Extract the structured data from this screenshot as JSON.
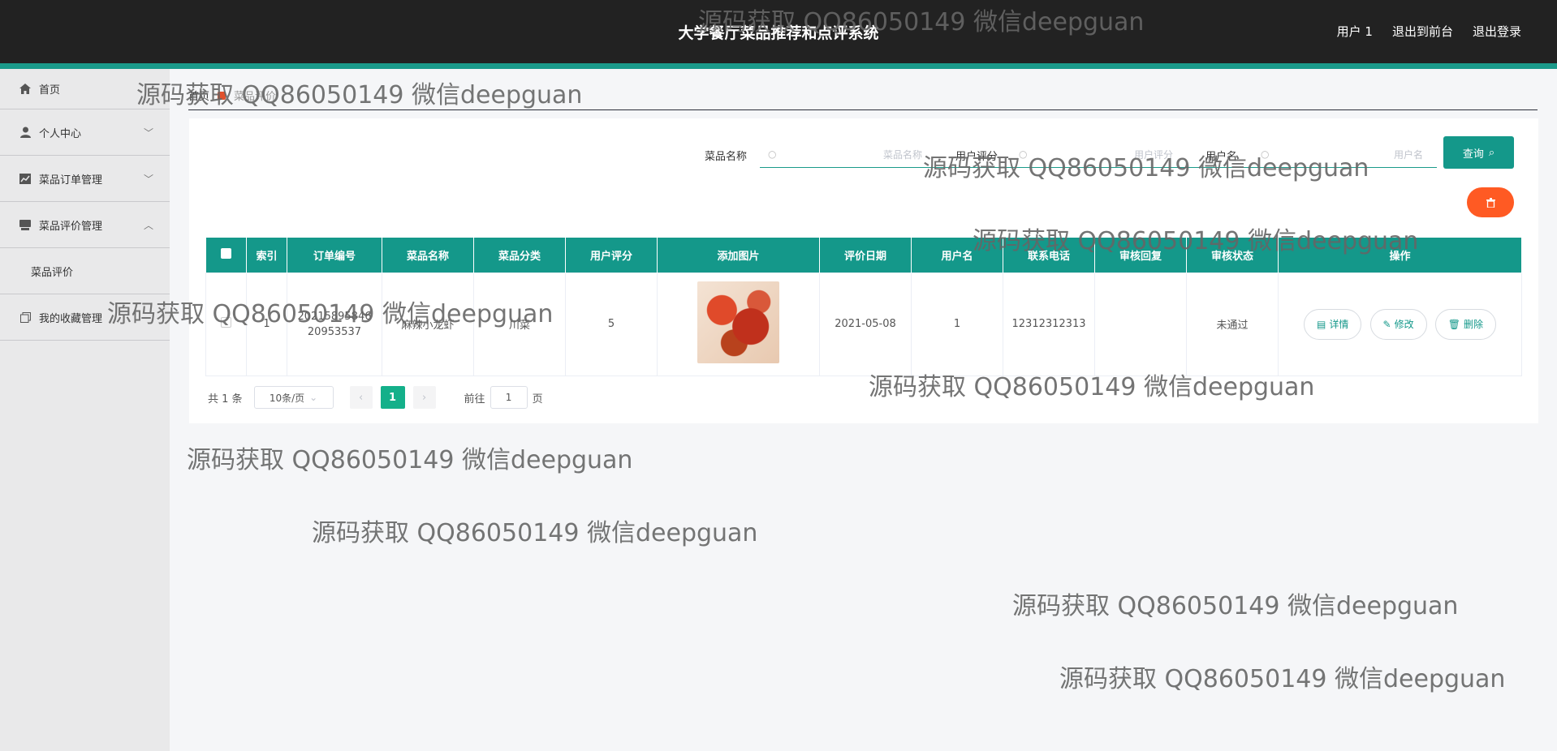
{
  "header": {
    "title": "大学餐厅菜品推荐和点评系统",
    "user": "用户 1",
    "to_front": "退出到前台",
    "logout": "退出登录"
  },
  "sidebar": {
    "items": [
      {
        "label": "首页",
        "icon": "home-icon"
      },
      {
        "label": "个人中心",
        "icon": "user-icon"
      },
      {
        "label": "菜品订单管理",
        "icon": "chart-icon"
      },
      {
        "label": "菜品评价管理",
        "icon": "tray-icon"
      },
      {
        "label": "菜品评价"
      },
      {
        "label": "我的收藏管理",
        "icon": "copy-icon"
      }
    ]
  },
  "breadcrumb": {
    "home": "首页",
    "current": "菜品评价"
  },
  "search": {
    "dish_label": "菜品名称",
    "dish_placeholder": "菜品名称",
    "rating_label": "用户评分",
    "rating_placeholder": "用户评分",
    "username_label": "用户名",
    "username_placeholder": "用户名",
    "query": "查询"
  },
  "table": {
    "headers": [
      "索引",
      "订单编号",
      "菜品名称",
      "菜品分类",
      "用户评分",
      "添加图片",
      "评价日期",
      "用户名",
      "联系电话",
      "审核回复",
      "审核状态",
      "操作"
    ],
    "rows": [
      {
        "index": "1",
        "order_no": "202158958462095353​7",
        "order_no_line1": "20215895846",
        "order_no_line2": "20953537",
        "dish": "麻辣小龙虾",
        "category": "川菜",
        "rating": "5",
        "date": "2021-05-08",
        "username": "1",
        "phone": "12312312313",
        "reply": "",
        "status": "未通过"
      }
    ],
    "actions": {
      "detail": "详情",
      "edit": "修改",
      "delete": "删除"
    }
  },
  "pager": {
    "total": "共 1 条",
    "page_size": "10条/页",
    "current_page": "1",
    "goto": "前往",
    "goto_value": "1",
    "page_unit": "页"
  },
  "watermark": "源码获取 QQ86050149 微信deepguan",
  "colors": {
    "header_bg": "#222222",
    "accent": "#14988a",
    "danger": "#ff5a23"
  }
}
